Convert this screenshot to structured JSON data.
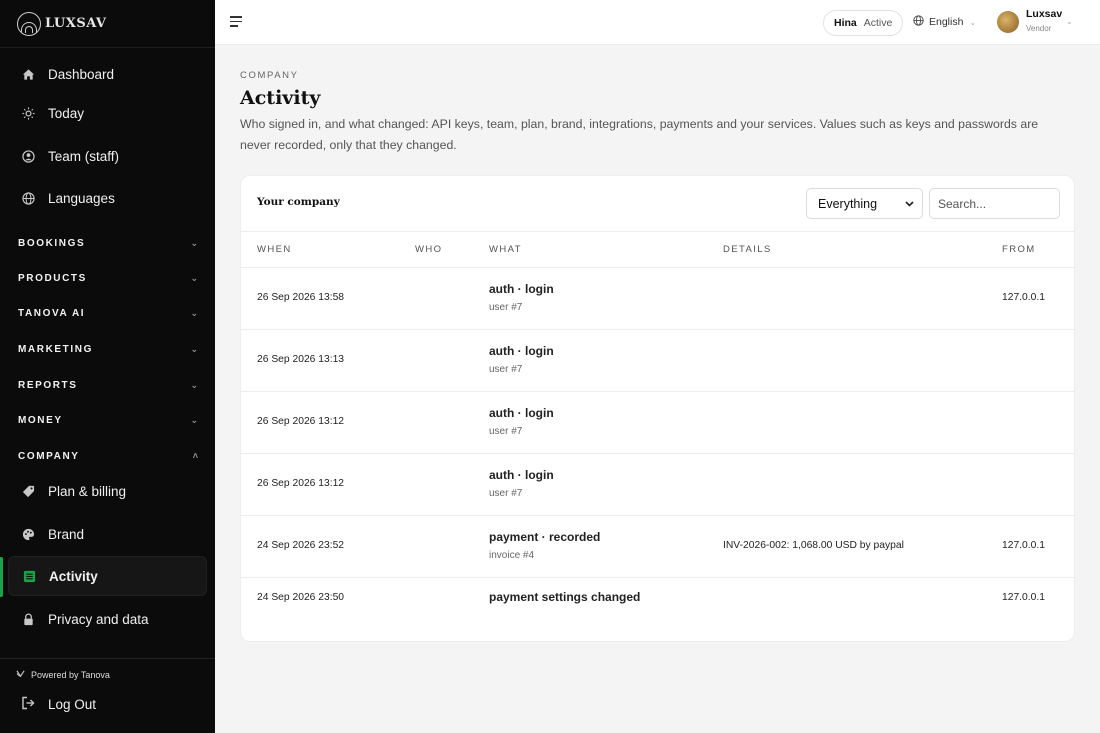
{
  "app": {
    "brand": "LUXSAV"
  },
  "sidebar": {
    "top_items": [
      {
        "label": "Dashboard",
        "icon": "home-icon"
      },
      {
        "label": "Today",
        "icon": "sun-icon"
      },
      {
        "label": "Team (staff)",
        "icon": "team-icon"
      },
      {
        "label": "Languages",
        "icon": "globe-icon"
      }
    ],
    "sections": [
      {
        "label": "BOOKINGS",
        "expanded": false
      },
      {
        "label": "PRODUCTS",
        "expanded": false
      },
      {
        "label": "TANOVA AI",
        "expanded": false
      },
      {
        "label": "MARKETING",
        "expanded": false
      },
      {
        "label": "REPORTS",
        "expanded": false
      },
      {
        "label": "MONEY",
        "expanded": false
      },
      {
        "label": "COMPANY",
        "expanded": true
      }
    ],
    "company_items": [
      {
        "label": "Plan & billing",
        "icon": "tag-icon"
      },
      {
        "label": "Brand",
        "icon": "palette-icon"
      },
      {
        "label": "Activity",
        "icon": "list-icon",
        "active": true
      },
      {
        "label": "Privacy and data",
        "icon": "lock-icon"
      }
    ],
    "powered_by": "Powered by Tanova",
    "logout": "Log Out",
    "accent_color": "#16a34a"
  },
  "topbar": {
    "status_name": "Hina",
    "status_state": "Active",
    "language": "English",
    "user_name": "Luxsav",
    "user_role": "Vendor"
  },
  "page": {
    "eyebrow": "COMPANY",
    "title": "Activity",
    "description": "Who signed in, and what changed: API keys, team, plan, brand, integrations, payments and your services. Values such as keys and passwords are never recorded, only that they changed."
  },
  "card": {
    "title": "Your company",
    "filter_value": "Everything",
    "search_placeholder": "Search...",
    "columns": [
      "WHEN",
      "WHO",
      "WHAT",
      "DETAILS",
      "FROM"
    ],
    "rows": [
      {
        "when": "26 Sep 2026 13:58",
        "who": "",
        "what": "auth · login",
        "what_sub": "user #7",
        "details": "",
        "from": "127.0.0.1"
      },
      {
        "when": "26 Sep 2026 13:13",
        "who": "",
        "what": "auth · login",
        "what_sub": "user #7",
        "details": "",
        "from": ""
      },
      {
        "when": "26 Sep 2026 13:12",
        "who": "",
        "what": "auth · login",
        "what_sub": "user #7",
        "details": "",
        "from": ""
      },
      {
        "when": "26 Sep 2026 13:12",
        "who": "",
        "what": "auth · login",
        "what_sub": "user #7",
        "details": "",
        "from": ""
      },
      {
        "when": "24 Sep 2026 23:52",
        "who": "",
        "what": "payment · recorded",
        "what_sub": "invoice #4",
        "details": "INV-2026-002: 1,068.00 USD by paypal",
        "from": "127.0.0.1"
      },
      {
        "when": "24 Sep 2026 23:50",
        "who": "",
        "what": "payment settings changed",
        "what_sub": "",
        "details": "",
        "from": "127.0.0.1"
      }
    ]
  }
}
